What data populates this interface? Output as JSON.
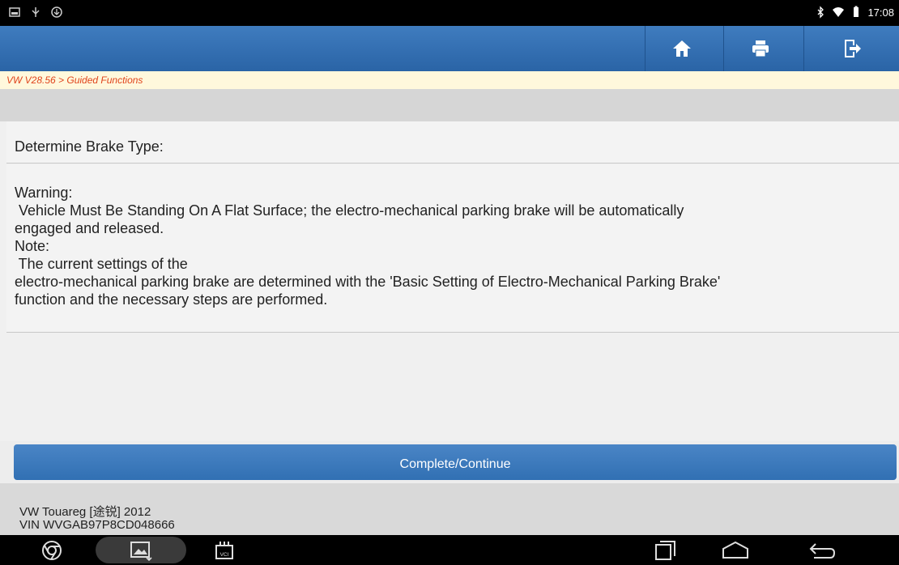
{
  "statusbar": {
    "time": "17:08",
    "left_icons": [
      "image-icon",
      "usb-icon",
      "download-icon"
    ],
    "right_icons": [
      "bluetooth-icon",
      "wifi-icon",
      "battery-icon"
    ]
  },
  "toolbar": {
    "buttons": [
      "home-icon",
      "print-icon",
      "exit-icon"
    ]
  },
  "breadcrumb": "VW V28.56 > Guided Functions",
  "content": {
    "heading": "Determine Brake Type:",
    "lines": [
      "Warning:",
      " Vehicle Must Be Standing On A Flat Surface; the electro-mechanical parking brake will be automatically",
      "engaged and released.",
      "Note:",
      " The current settings of the",
      "electro-mechanical parking brake are determined with the 'Basic Setting of Electro-Mechanical Parking Brake'",
      "function and the necessary steps are performed."
    ]
  },
  "continue_label": "Complete/Continue",
  "footer": {
    "vehicle": "VW Touareg [途锐] 2012",
    "vin": "VIN WVGAB97P8CD048666"
  },
  "navbar": {
    "vci_label": "VCI",
    "icons": [
      "chrome-icon",
      "gallery-icon",
      "vci-icon",
      "recent-apps-icon",
      "home-nav-icon",
      "back-icon"
    ]
  },
  "colors": {
    "toolbar": "#2f6cae",
    "breadcrumb_text": "#e0441c",
    "button": "#3a78bb"
  }
}
